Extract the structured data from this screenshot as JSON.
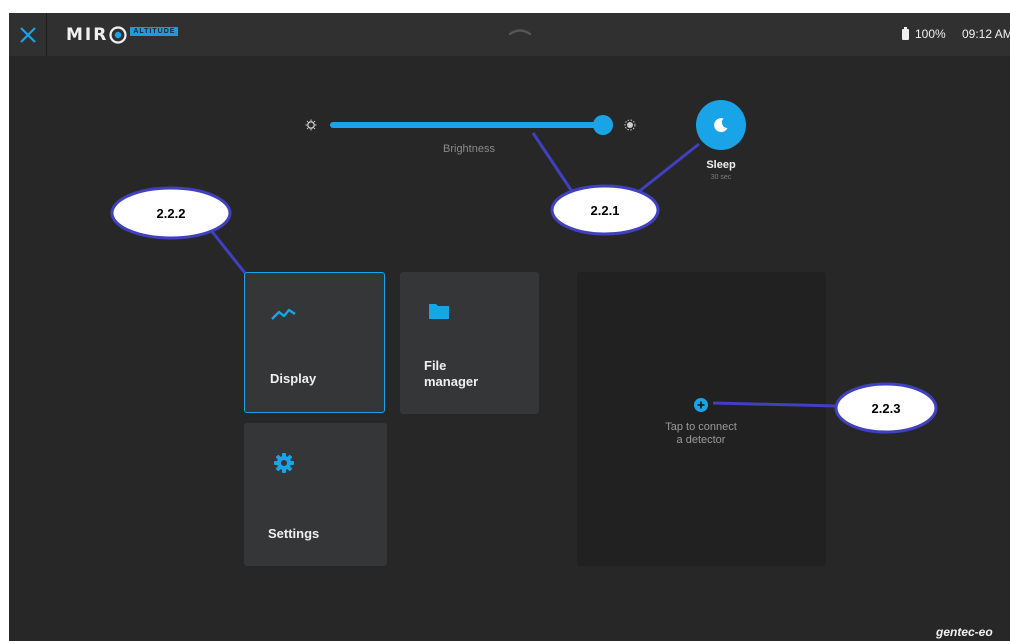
{
  "topbar": {
    "logo_text": "MIR",
    "logo_badge": "ALTITUDE",
    "battery": "100%",
    "time": "09:12 AM"
  },
  "controls": {
    "brightness_label": "Brightness",
    "brightness_level": 0.96,
    "sleep_label": "Sleep",
    "sleep_value": "30 sec"
  },
  "tiles": {
    "display": "Display",
    "file_manager_line1": "File",
    "file_manager_line2": "manager",
    "settings": "Settings"
  },
  "detector": {
    "line1": "Tap to connect",
    "line2": "a detector"
  },
  "brand": "gentec-eo",
  "callouts": {
    "brightness_sleep": "2.2.1",
    "tiles": "2.2.2",
    "detector": "2.2.3"
  },
  "colors": {
    "accent": "#19a4e7",
    "background": "#272727",
    "tile": "#353638",
    "callout_line": "#4040c0"
  }
}
